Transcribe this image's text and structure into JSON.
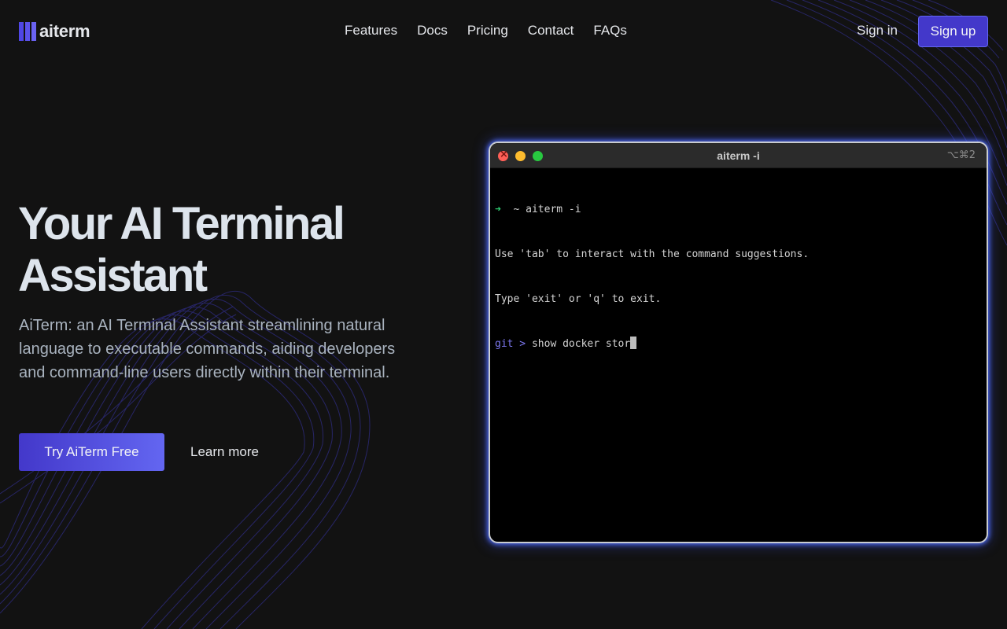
{
  "brand": {
    "name": "aiterm"
  },
  "nav": {
    "items": [
      {
        "label": "Features"
      },
      {
        "label": "Docs"
      },
      {
        "label": "Pricing"
      },
      {
        "label": "Contact"
      },
      {
        "label": "FAQs"
      }
    ]
  },
  "auth": {
    "signin_label": "Sign in",
    "signup_label": "Sign up"
  },
  "hero": {
    "title_line1": "Your AI Terminal",
    "title_line2": "Assistant",
    "description": "AiTerm: an AI Terminal Assistant streamlining natural language to executable commands, aiding developers and command-line users directly within their terminal.",
    "primary_cta": "Try AiTerm Free",
    "secondary_cta": "Learn more"
  },
  "terminal": {
    "title": "aiterm -i",
    "shortcut": "⌥⌘2",
    "prompt_arrow": "➜",
    "prompt_dir": "~",
    "command": "aiterm -i",
    "output_line1": "Use 'tab' to interact with the command suggestions.",
    "output_line2": "Type 'exit' or 'q' to exit.",
    "context_prompt": "git >",
    "input_text": "show docker stor"
  },
  "colors": {
    "background": "#121212",
    "accent": "#4f46e5",
    "accent_light": "#6366f1",
    "terminal_glow": "#5a6eff"
  },
  "icons": {
    "logo": "bars-logo-icon",
    "window_close": "close-dot-icon",
    "window_minimize": "minimize-dot-icon",
    "window_zoom": "zoom-dot-icon"
  }
}
